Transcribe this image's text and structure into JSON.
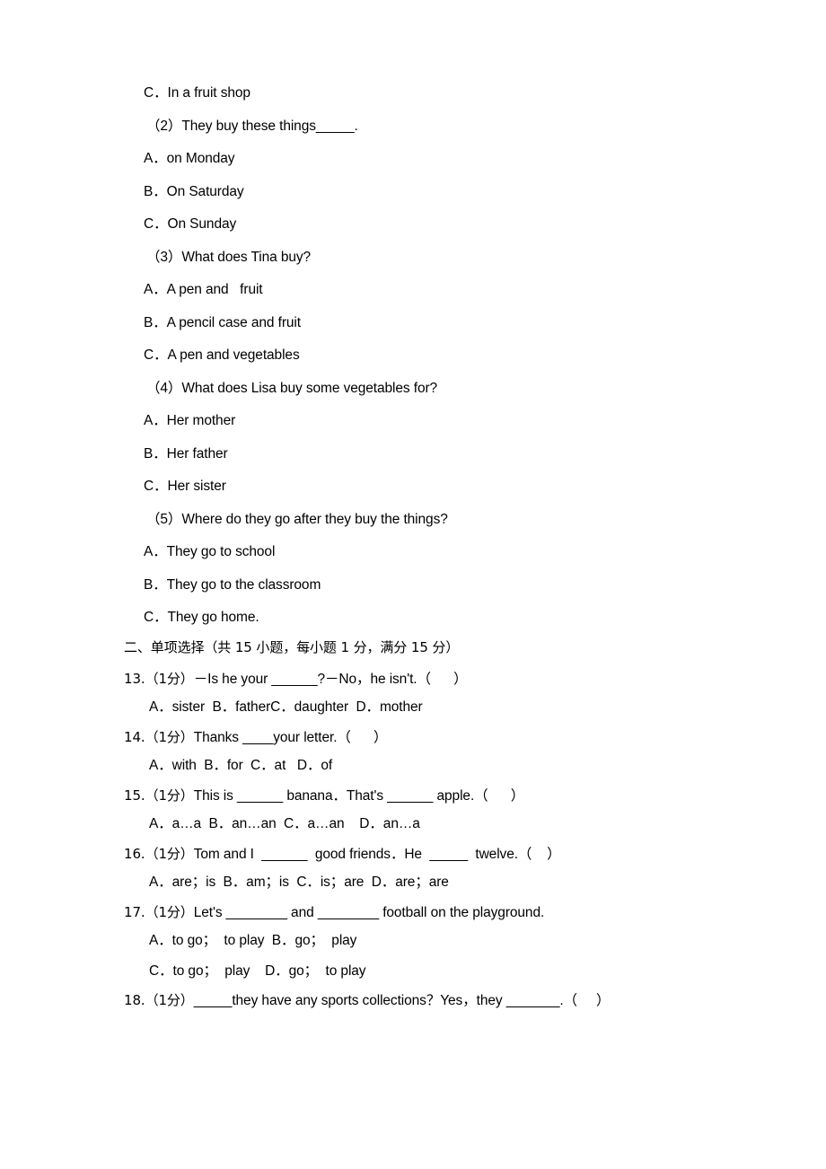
{
  "document": {
    "type": "english-exam-paper",
    "page_background": "#ffffff",
    "text_color": "#000000"
  },
  "reading_section": {
    "continued_option": "C．In a fruit shop",
    "questions": [
      {
        "number": "（2）",
        "stem": "They buy these things_____.",
        "options": [
          "A．on Monday",
          "B．On Saturday",
          "C．On Sunday"
        ]
      },
      {
        "number": "（3）",
        "stem": "What does Tina buy?",
        "options": [
          "A．A pen and   fruit",
          "B．A pencil case and fruit",
          "C．A pen and vegetables"
        ]
      },
      {
        "number": "（4）",
        "stem": "What does Lisa buy some vegetables for?",
        "options": [
          "A．Her mother",
          "B．Her father",
          "C．Her sister"
        ]
      },
      {
        "number": "（5）",
        "stem": "Where do they go after they buy the things?",
        "options": [
          "A．They go to school",
          "B．They go to the classroom",
          "C．They go home."
        ]
      }
    ]
  },
  "choice_section": {
    "heading": "二、单项选择（共 15 小题，每小题 1 分，满分 15 分）",
    "questions": [
      {
        "number": "13.",
        "points": "（1分）",
        "stem": "－Is he your ______?－No，he isn't.（      ）",
        "option_lines": [
          "A．sister  B．fatherC．daughter  D．mother"
        ]
      },
      {
        "number": "14.",
        "points": "（1分）",
        "stem": "Thanks ____your letter.（      ）",
        "option_lines": [
          "A．with  B．for  C．at   D．of"
        ]
      },
      {
        "number": "15.",
        "points": "（1分）",
        "stem": "This is ______ banana．That's ______ apple.（      ）",
        "option_lines": [
          "A．a…a  B．an…an  C．a…an    D．an…a"
        ]
      },
      {
        "number": "16.",
        "points": "（1分）",
        "stem": "Tom and I  ______  good friends．He  _____  twelve.（    ）",
        "option_lines": [
          "A．are；is  B．am；is  C．is；are  D．are；are"
        ]
      },
      {
        "number": "17.",
        "points": "（1分）",
        "stem": "Let's ________ and ________ football on the playground.",
        "option_lines": [
          "A．to go；  to play  B．go；  play",
          "C．to go；  play    D．go；  to play"
        ]
      },
      {
        "number": "18.",
        "points": "（1分）",
        "stem": "_____they have any sports collections？Yes，they _______.（     ）",
        "option_lines": []
      }
    ]
  }
}
